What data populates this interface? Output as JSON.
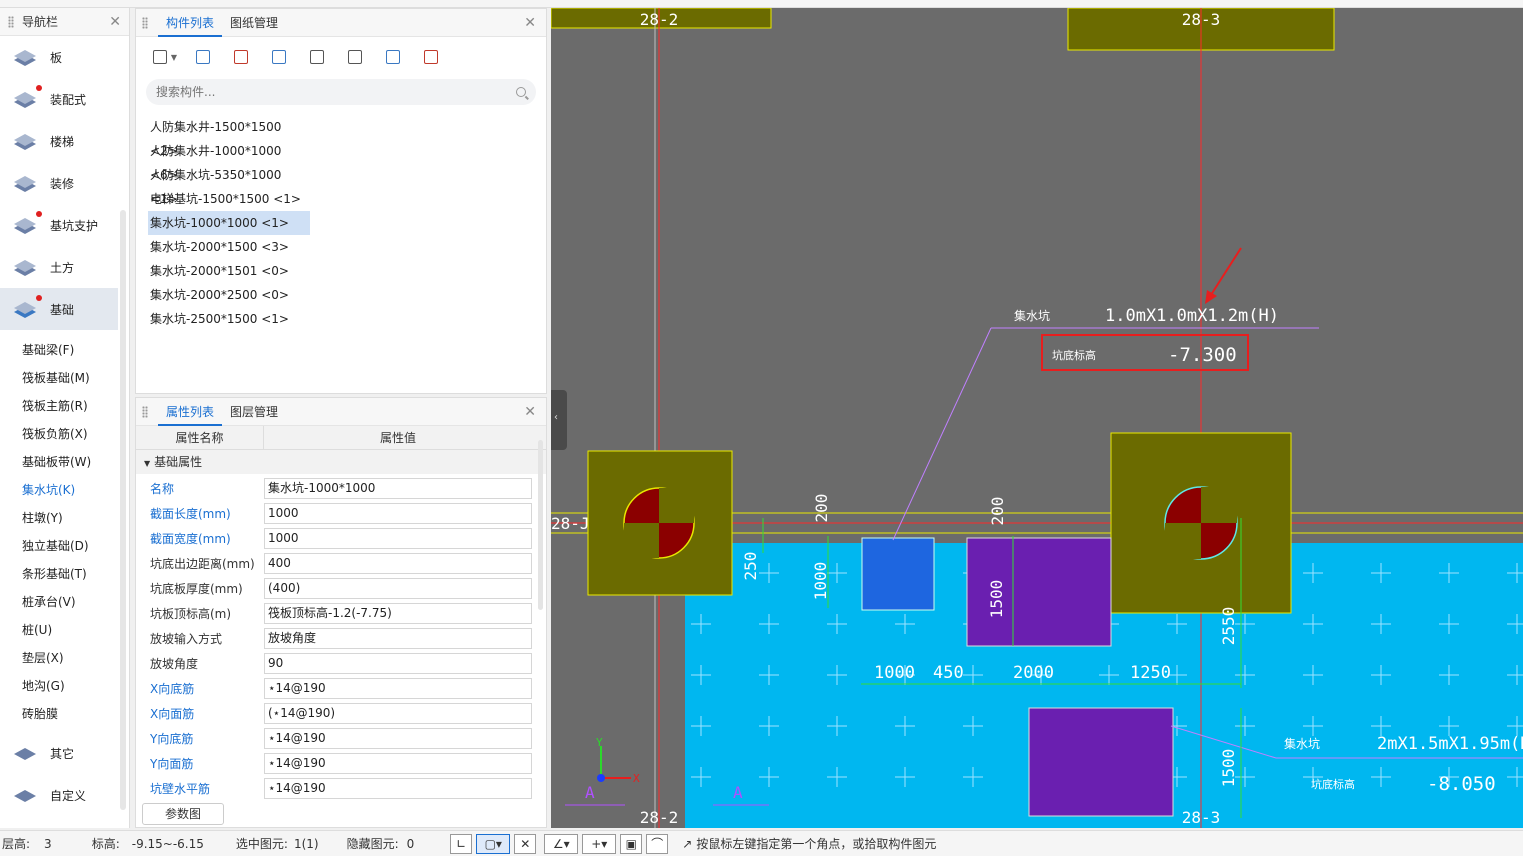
{
  "nav": {
    "title": "导航栏",
    "items": [
      {
        "label": "板",
        "icon": "slab-icon",
        "dot": false
      },
      {
        "label": "装配式",
        "icon": "prefab-icon",
        "dot": true
      },
      {
        "label": "楼梯",
        "icon": "stairs-icon",
        "dot": false
      },
      {
        "label": "装修",
        "icon": "decoration-icon",
        "dot": false
      },
      {
        "label": "基坑支护",
        "icon": "pit-support-icon",
        "dot": true
      },
      {
        "label": "土方",
        "icon": "earthwork-icon",
        "dot": false
      },
      {
        "label": "基础",
        "icon": "foundation-icon",
        "dot": true
      }
    ],
    "subitems": [
      "基础梁(F)",
      "筏板基础(M)",
      "筏板主筋(R)",
      "筏板负筋(X)",
      "基础板带(W)",
      "集水坑(K)",
      "柱墩(Y)",
      "独立基础(D)",
      "条形基础(T)",
      "桩承台(V)",
      "桩(U)",
      "垫层(X)",
      "地沟(G)",
      "砖胎膜"
    ],
    "selected_sub": "集水坑(K)",
    "bottom_items": [
      {
        "label": "其它",
        "icon": "other-icon"
      },
      {
        "label": "自定义",
        "icon": "custom-icon"
      }
    ]
  },
  "complist": {
    "tabs": [
      "构件列表",
      "图纸管理"
    ],
    "search_placeholder": "搜索构件...",
    "items": [
      "人防集水井-1500*1500 <2>",
      "人防集水井-1000*1000 <6>",
      "人防集水坑-5350*1000 <1>",
      "电梯基坑-1500*1500 <1>",
      "集水坑-1000*1000 <1>",
      "集水坑-2000*1500 <3>",
      "集水坑-2000*1501 <0>",
      "集水坑-2000*2500 <0>",
      "集水坑-2500*1500 <1>"
    ],
    "selected": "集水坑-1000*1000 <1>"
  },
  "props": {
    "tabs": [
      "属性列表",
      "图层管理"
    ],
    "col_name": "属性名称",
    "col_value": "属性值",
    "group": "基础属性",
    "rows": [
      {
        "k": "名称",
        "v": "集水坑-1000*1000",
        "blue": true
      },
      {
        "k": "截面长度(mm)",
        "v": "1000",
        "blue": true
      },
      {
        "k": "截面宽度(mm)",
        "v": "1000",
        "blue": true
      },
      {
        "k": "坑底出边距离(mm)",
        "v": "400",
        "blue": false
      },
      {
        "k": "坑底板厚度(mm)",
        "v": "(400)",
        "blue": false
      },
      {
        "k": "坑板顶标高(m)",
        "v": "筏板顶标高-1.2(-7.75)",
        "blue": false
      },
      {
        "k": "放坡输入方式",
        "v": "放坡角度",
        "blue": false
      },
      {
        "k": "放坡角度",
        "v": "90",
        "blue": false
      },
      {
        "k": "X向底筋",
        "v": "⋆14@190",
        "blue": true
      },
      {
        "k": "X向面筋",
        "v": "(⋆14@190)",
        "blue": true
      },
      {
        "k": "Y向底筋",
        "v": "⋆14@190",
        "blue": true
      },
      {
        "k": "Y向面筋",
        "v": "⋆14@190",
        "blue": true
      },
      {
        "k": "坑壁水平筋",
        "v": "⋆14@190",
        "blue": true
      }
    ],
    "param_button": "参数图"
  },
  "canvas": {
    "axis_labels": {
      "top_left": "28-2",
      "top_right": "28-3",
      "bottom_left": "28-2",
      "bottom_right": "28-3",
      "row": "28-J"
    },
    "label1_name": "集水坑",
    "label1_size": "1.0mX1.0mX1.2m(H)",
    "label1_elev_name": "坑底标高",
    "label1_elev": "-7.300",
    "label2_name": "集水坑",
    "label2_size": "2mX1.5mX1.95m(H)",
    "label2_elev_name": "坑底标高",
    "label2_elev": "-8.050",
    "dims": {
      "d200a": "200",
      "d200b": "200",
      "d250": "250",
      "d1000v": "1000",
      "d1500v": "1500",
      "d2550": "2550",
      "d1000h": "1000",
      "d450": "450",
      "d2000": "2000",
      "d1250": "1250",
      "d1500b": "1500"
    },
    "axis_x": "X",
    "axis_y": "Y",
    "mark_a1": "A",
    "mark_a2": "A"
  },
  "status": {
    "floor_label": "层高:",
    "floor_value": "3",
    "elev_label": "标高:",
    "elev_value": "-9.15~-6.15",
    "sel_label": "选中图元:",
    "sel_value": "1(1)",
    "hidden_label": "隐藏图元:",
    "hidden_value": "0",
    "hint": "按鼠标左键指定第一个角点，或拾取构件图元"
  },
  "colors": {
    "canvas_bg": "#6b6b6b",
    "raft": "#00b7f0",
    "pit_box": "#6b6b00",
    "accent": "#1a6fd1"
  }
}
